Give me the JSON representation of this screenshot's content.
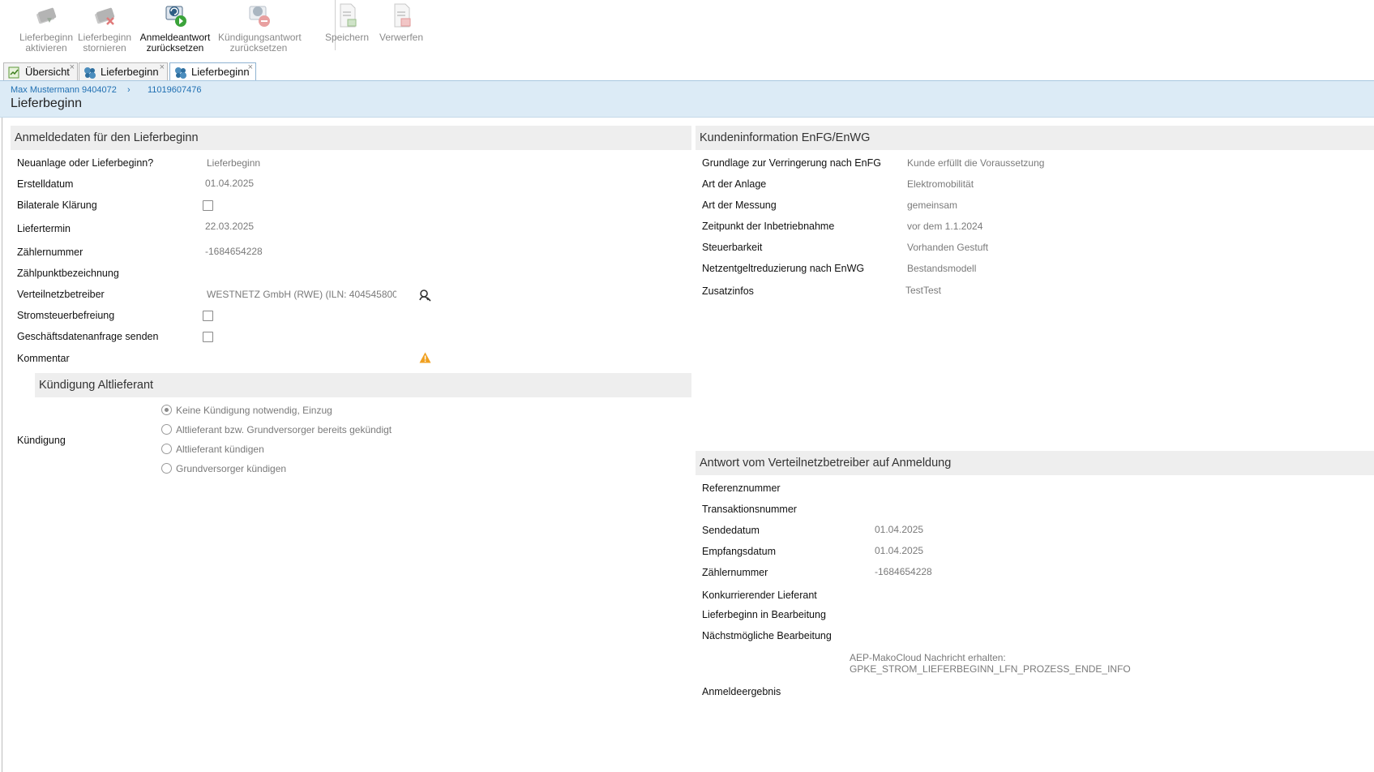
{
  "toolbar": {
    "buttons": [
      {
        "line1": "Lieferbeginn",
        "line2": "aktivieren"
      },
      {
        "line1": "Lieferbeginn",
        "line2": "stornieren"
      },
      {
        "line1": "Anmeldeantwort",
        "line2": "zurücksetzen"
      },
      {
        "line1": "Kündigungsantwort",
        "line2": "zurücksetzen"
      },
      {
        "line1": "Speichern",
        "line2": ""
      },
      {
        "line1": "Verwerfen",
        "line2": ""
      }
    ]
  },
  "tabs": [
    {
      "label": "Übersicht",
      "close": "×"
    },
    {
      "label": "Lieferbeginn",
      "close": "×"
    },
    {
      "label": "Lieferbeginn",
      "close": "×"
    }
  ],
  "header": {
    "breadcrumb_customer": "Max Mustermann 9404072",
    "breadcrumb_separator": "›",
    "breadcrumb_id": "11019607476",
    "title": "Lieferbeginn"
  },
  "anmeldedaten": {
    "title": "Anmeldedaten für den Lieferbeginn",
    "fields": {
      "neuanlage_label": "Neuanlage oder Lieferbeginn?",
      "neuanlage_value": "Lieferbeginn",
      "erstelldatum_label": "Erstelldatum",
      "erstelldatum_value": "01.04.2025",
      "bilaterale_label": "Bilaterale Klärung",
      "liefertermin_label": "Liefertermin",
      "liefertermin_value": "22.03.2025",
      "zaehlernummer_label": "Zählernummer",
      "zaehlernummer_value": "-1684654228",
      "zaehlpunkt_label": "Zählpunktbezeichnung",
      "verteilnetz_label": "Verteilnetzbetreiber",
      "verteilnetz_value": "WESTNETZ GmbH (RWE) (ILN: 404545800",
      "stromsteuer_label": "Stromsteuerbefreiung",
      "geschaeftsdaten_label": "Geschäftsdatenanfrage senden",
      "kommentar_label": "Kommentar"
    }
  },
  "kuendigung": {
    "title": "Kündigung Altlieferant",
    "label": "Kündigung",
    "options": [
      "Keine Kündigung notwendig, Einzug",
      "Altlieferant bzw. Grundversorger bereits gekündigt",
      "Altlieferant kündigen",
      "Grundversorger kündigen"
    ],
    "selected_index": 0
  },
  "kundeninfo": {
    "title": "Kundeninformation EnFG/EnWG",
    "rows": [
      {
        "label": "Grundlage zur Verringerung nach EnFG",
        "value": "Kunde erfüllt die Voraussetzung"
      },
      {
        "label": "Art der Anlage",
        "value": "Elektromobilität"
      },
      {
        "label": "Art der Messung",
        "value": "gemeinsam"
      },
      {
        "label": "Zeitpunkt der Inbetriebnahme",
        "value": "vor dem 1.1.2024"
      },
      {
        "label": "Steuerbarkeit",
        "value": "Vorhanden Gestuft"
      },
      {
        "label": "Netzentgeltreduzierung nach EnWG",
        "value": "Bestandsmodell"
      },
      {
        "label": "Zusatzinfos",
        "value": "TestTest"
      }
    ]
  },
  "antwort": {
    "title": "Antwort vom Verteilnetzbetreiber auf Anmeldung",
    "referenz_label": "Referenznummer",
    "transaktion_label": "Transaktionsnummer",
    "sendedatum_label": "Sendedatum",
    "sendedatum_value": "01.04.2025",
    "empfangsdatum_label": "Empfangsdatum",
    "empfangsdatum_value": "01.04.2025",
    "zaehlernummer_label": "Zählernummer",
    "zaehlernummer_value": "-1684654228",
    "konkurrierend_label": "Konkurrierender Lieferant",
    "in_bearbeitung_label": "Lieferbeginn in Bearbeitung",
    "naechst_label": "Nächstmögliche Bearbeitung",
    "nachricht_line1": "AEP-MakoCloud Nachricht erhalten:",
    "nachricht_line2": "GPKE_STROM_LIEFERBEGINN_LFN_PROZESS_ENDE_INFO",
    "anmeldeergebnis_label": "Anmeldeergebnis"
  },
  "colors": {
    "header_bg": "#dcebf6",
    "link": "#1f6fb2",
    "section_bg": "#eeeeee",
    "warning": "#f0a020"
  }
}
